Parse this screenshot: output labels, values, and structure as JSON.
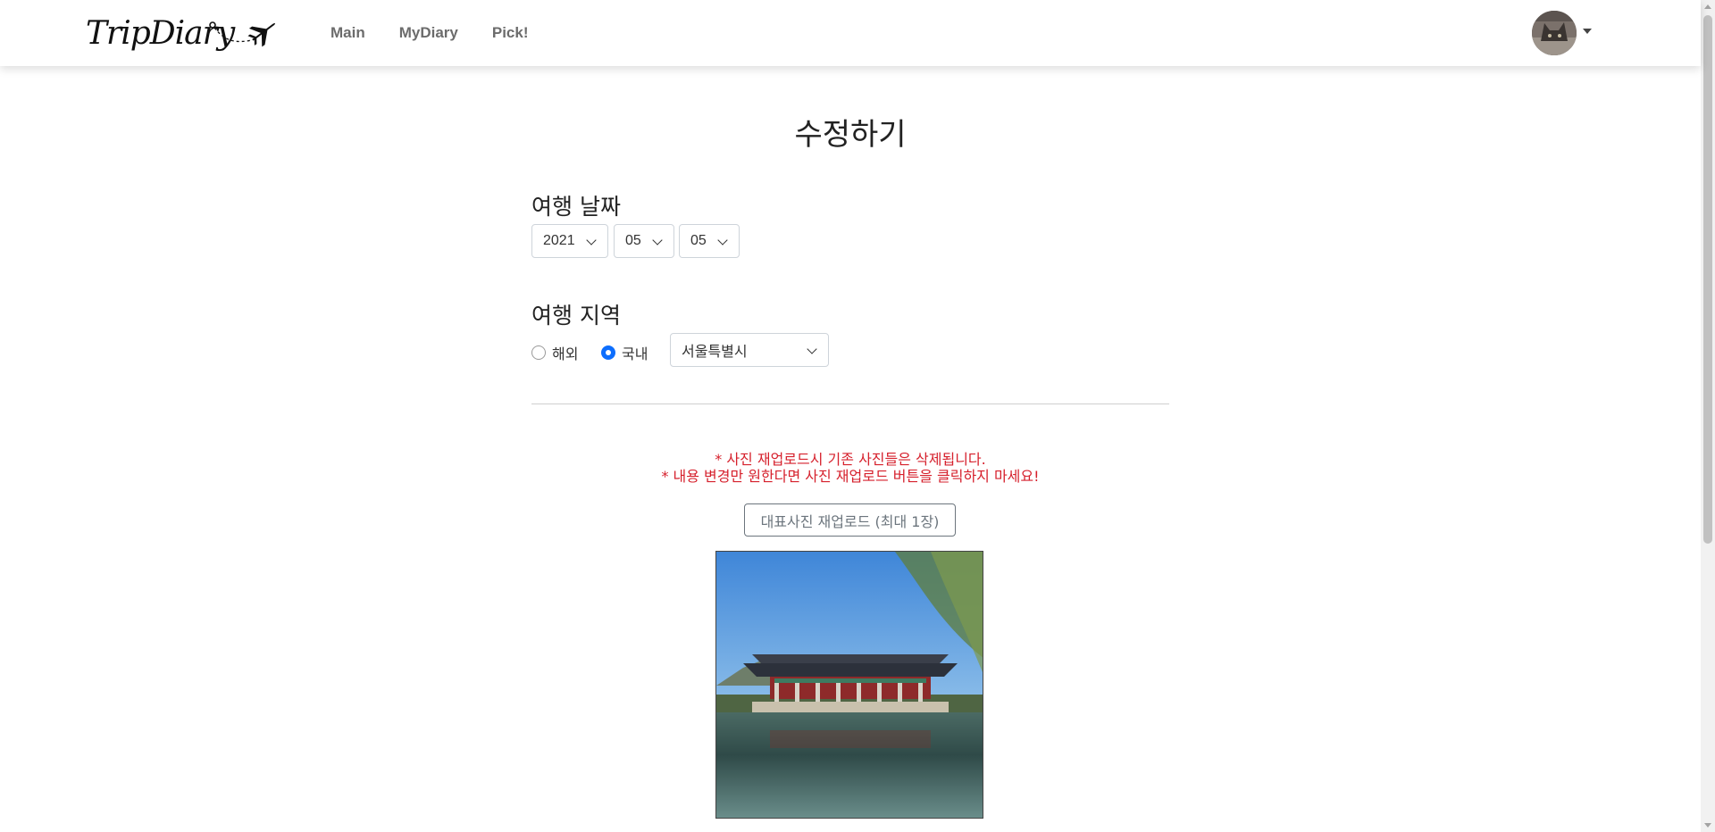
{
  "navbar": {
    "logo_text": "TripDiary",
    "links": [
      "Main",
      "MyDiary",
      "Pick!"
    ]
  },
  "page": {
    "title": "수정하기"
  },
  "date_section": {
    "label": "여행 날짜",
    "year": "2021",
    "month": "05",
    "day": "05"
  },
  "region_section": {
    "label": "여행 지역",
    "options": [
      "해외",
      "국내"
    ],
    "selected_option": "국내",
    "region_value": "서울특별시"
  },
  "notices": [
    "* 사진 재업로드시 기존 사진들은 삭제됩니다.",
    "* 내용 변경만 원한다면 사진 재업로드 버튼을 클릭하지 마세요!"
  ],
  "upload_button_label": "대표사진 재업로드 (최대 1장)",
  "colors": {
    "notice": "#d6202c",
    "radio_checked": "#0d6efd"
  }
}
